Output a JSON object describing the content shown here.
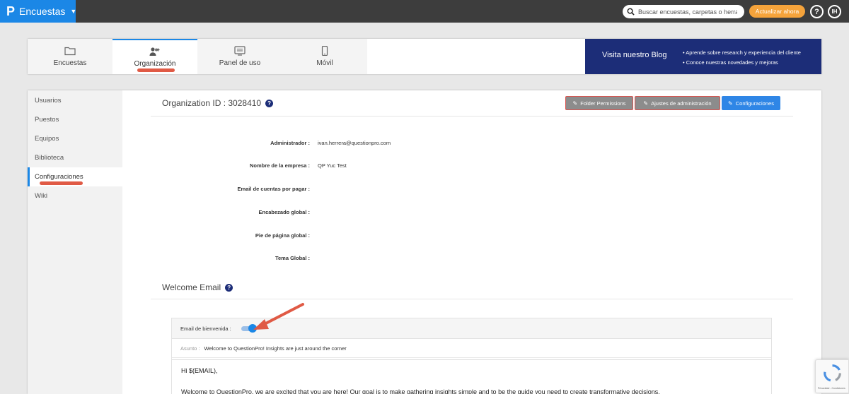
{
  "topbar": {
    "brand_logo": "P",
    "brand_name": "Encuestas",
    "search_placeholder": "Buscar encuestas, carpetas o herrami",
    "upgrade_label": "Actualizar ahora",
    "help_label": "?",
    "avatar_initials": "IH",
    "brand_color": "#1b87e6",
    "upgrade_color": "#f5a33b"
  },
  "tabs": [
    {
      "label": "Encuestas",
      "icon": "folder-icon",
      "active": false
    },
    {
      "label": "Organización",
      "icon": "add-user-icon",
      "active": true
    },
    {
      "label": "Panel de uso",
      "icon": "dashboard-icon",
      "active": false
    },
    {
      "label": "Móvil",
      "icon": "mobile-icon",
      "active": false
    }
  ],
  "blog": {
    "title": "Visita nuestro Blog",
    "bullets": [
      "Aprende sobre research y experiencia del cliente",
      "Conoce nuestras novedades y mejoras"
    ]
  },
  "sidebar": {
    "items": [
      {
        "label": "Usuarios",
        "active": false
      },
      {
        "label": "Puestos",
        "active": false
      },
      {
        "label": "Equipos",
        "active": false
      },
      {
        "label": "Biblioteca",
        "active": false
      },
      {
        "label": "Configuraciones",
        "active": true
      },
      {
        "label": "Wiki",
        "active": false
      }
    ]
  },
  "main": {
    "org_title": "Organization ID : 3028410",
    "buttons": {
      "folder_permissions": "Folder Permissions",
      "admin_settings": "Ajustes de administración",
      "configurations": "Configuraciones"
    },
    "fields": [
      {
        "label": "Administrador :",
        "value": "ivan.herrera@questionpro.com"
      },
      {
        "label": "Nombre de la empresa :",
        "value": "QP Yuc Test"
      },
      {
        "label": "Email de cuentas por pagar :",
        "value": ""
      },
      {
        "label": "Encabezado global :",
        "value": ""
      },
      {
        "label": "Pie de página global :",
        "value": ""
      },
      {
        "label": "Tema Global :",
        "value": ""
      }
    ],
    "welcome": {
      "title": "Welcome Email",
      "toggle_label": "Email de bienvenida :",
      "toggle_on": true,
      "subject_label": "Asunto :",
      "subject_value": "Welcome to QuestionPro! Insights are just around the corner",
      "body_greeting": "Hi $(EMAIL),",
      "body_line": "Welcome to QuestionPro, we are excited that you are here! Our goal is to make gathering insights simple and to be the guide you need to create transformative decisions."
    }
  },
  "recaptcha": {
    "text": "Privacidad - Condiciones"
  }
}
